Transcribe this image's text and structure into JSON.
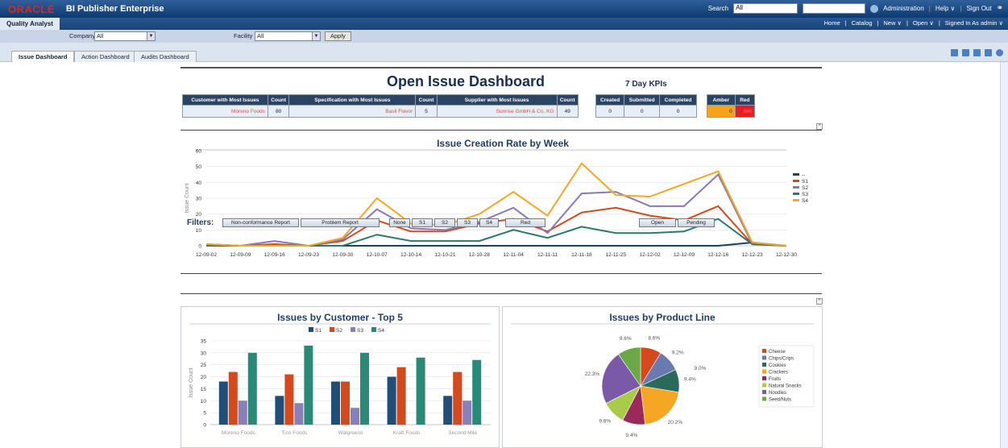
{
  "app": {
    "logo": "ORACLE",
    "product": "BI Publisher Enterprise"
  },
  "top": {
    "search_label": "Search",
    "search_scope": "All",
    "administration": "Administration",
    "help": "Help ∨",
    "sign_out": "Sign Out"
  },
  "role": "Quality Analyst",
  "nav": {
    "home": "Home",
    "catalog": "Catalog",
    "new": "New ∨",
    "open": "Open ∨",
    "signed_in": "Signed In As admin ∨"
  },
  "filters_bar": {
    "company_label": "Company",
    "company_value": "All",
    "facility_label": "Facility",
    "facility_value": "All",
    "apply": "Apply"
  },
  "tabs": [
    "Issue Dashboard",
    "Action Dashboard",
    "Audits Dashboard"
  ],
  "dashboard": {
    "title": "Open Issue Dashboard",
    "kpi_title": "7 Day KPIs",
    "summary_headers": [
      "Customer with Most Issues",
      "Count",
      "Specification with Most Issues",
      "Count",
      "Supplier with Most Issues",
      "Count"
    ],
    "summary_values": [
      "Moreno Foods",
      "80",
      "Basil Flavor",
      "5",
      "Sunrise GmbH & Co. KG",
      "49"
    ],
    "kpi_headers": [
      "Created",
      "Submitted",
      "Completed"
    ],
    "kpi_values": [
      "0",
      "0",
      "0"
    ],
    "status_headers": [
      "Amber",
      "Red"
    ],
    "status_values": [
      "0",
      "366"
    ],
    "colors": {
      "amber": "#f7a21a",
      "red": "#e81d1d",
      "header": "#2b4463"
    }
  },
  "filters": {
    "label": "Filters:",
    "buttons": [
      "Non-conformance Report",
      "Problem Report",
      "None",
      "S1",
      "S2",
      "S3",
      "S4",
      "Red",
      "Open",
      "Pending"
    ]
  },
  "chart_data": [
    {
      "type": "line",
      "title": "Issue Creation Rate by Week",
      "ylabel": "Issue Count",
      "ylim": [
        0,
        60
      ],
      "yticks": [
        0,
        10,
        20,
        30,
        40,
        50,
        60
      ],
      "x": [
        "12-09-02",
        "12-09-09",
        "12-09-16",
        "12-09-23",
        "12-09-30",
        "12-10-07",
        "12-10-14",
        "12-10-21",
        "12-10-28",
        "12-11-04",
        "12-11-11",
        "12-11-18",
        "12-11-25",
        "12-12-02",
        "12-12-09",
        "12-12-16",
        "12-12-23",
        "12-12-30"
      ],
      "legend": "right",
      "series": [
        {
          "name": "--",
          "color": "#1f3d66",
          "values": [
            0,
            0,
            0,
            0,
            0,
            0,
            0,
            0,
            0,
            0,
            0,
            0,
            0,
            0,
            0,
            0,
            2,
            0
          ]
        },
        {
          "name": "S1",
          "color": "#d44a1c",
          "values": [
            1,
            0,
            1,
            0,
            3,
            16,
            9,
            9,
            14,
            17,
            9,
            21,
            24,
            19,
            16,
            25,
            1,
            0
          ]
        },
        {
          "name": "S2",
          "color": "#8a78b8",
          "values": [
            1,
            0,
            3,
            0,
            4,
            23,
            11,
            10,
            15,
            24,
            8,
            33,
            34,
            25,
            25,
            45,
            1,
            0
          ]
        },
        {
          "name": "S3",
          "color": "#2a7a6a",
          "values": [
            0,
            0,
            0,
            0,
            0,
            7,
            3,
            3,
            3,
            10,
            5,
            12,
            8,
            8,
            9,
            17,
            1,
            0
          ]
        },
        {
          "name": "S4",
          "color": "#f5a623",
          "values": [
            1,
            0,
            0,
            0,
            5,
            30,
            14,
            13,
            20,
            34,
            19,
            52,
            32,
            31,
            39,
            47,
            2,
            0
          ]
        }
      ]
    },
    {
      "type": "bar",
      "title": "Issues by Customer - Top 5",
      "ylabel": "Issue Count",
      "ylim": [
        0,
        35
      ],
      "yticks": [
        0,
        5,
        10,
        15,
        20,
        25,
        30,
        35
      ],
      "categories": [
        "Moreno Foods",
        "Tico Foods",
        "Walgreens",
        "Kraft Foods",
        "Second Mile"
      ],
      "legend": "top",
      "series": [
        {
          "name": "S1",
          "color": "#1f4e79",
          "values": [
            18,
            12,
            18,
            20,
            12
          ]
        },
        {
          "name": "S2",
          "color": "#d44a1c",
          "values": [
            22,
            21,
            18,
            24,
            22
          ]
        },
        {
          "name": "S3",
          "color": "#8a7fb8",
          "values": [
            10,
            9,
            7,
            0,
            10
          ]
        },
        {
          "name": "S4",
          "color": "#2a8a78",
          "values": [
            30,
            33,
            30,
            28,
            27
          ]
        }
      ]
    },
    {
      "type": "pie",
      "title": "Issues by Product Line",
      "legend": "right",
      "slices": [
        {
          "name": "Cheese",
          "value": 8.6,
          "label": "8.6%",
          "color": "#d44a1c"
        },
        {
          "name": "Chips/Crips",
          "value": 9.2,
          "label": "9.2%",
          "color": "#6a7ab0"
        },
        {
          "name": "Cookies",
          "value": 9.4,
          "label": "9.4%",
          "color": "#2a6a5a"
        },
        {
          "name": "Crackers",
          "value": 20.2,
          "label": "20.2%",
          "color": "#f5a623"
        },
        {
          "name": "Fruits",
          "value": 9.4,
          "label": "9.4%",
          "color": "#9a2a5a"
        },
        {
          "name": "Natural Snacks",
          "value": 9.8,
          "label": "9.8%",
          "color": "#a8cc4a"
        },
        {
          "name": "Noodles",
          "value": 22.3,
          "label": "22.3%",
          "color": "#7a5aa8"
        },
        {
          "name": "Seed/Nuts",
          "value": 9.6,
          "label": "9.6%",
          "color": "#6aa84a"
        }
      ],
      "extra_label": "9.0%"
    }
  ]
}
